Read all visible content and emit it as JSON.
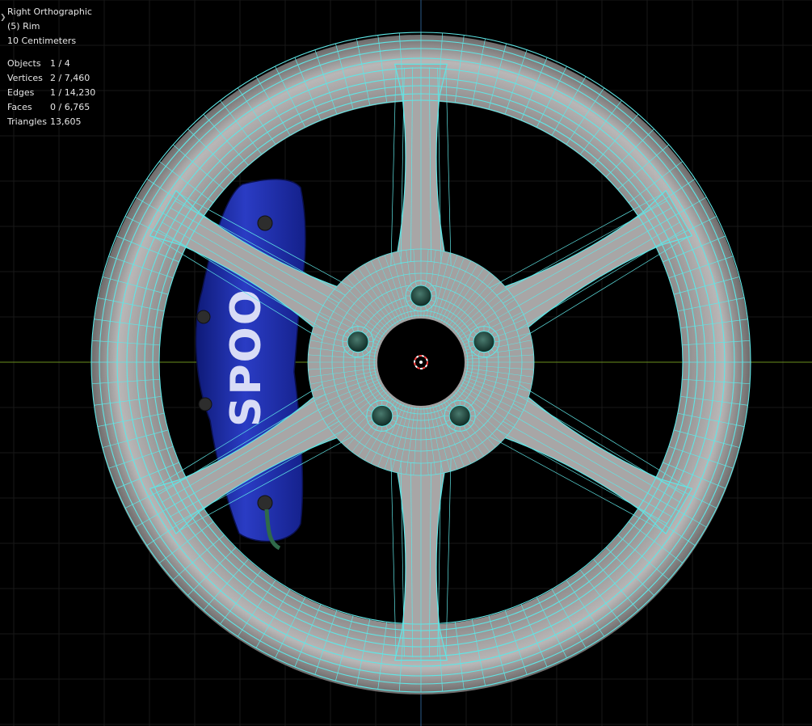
{
  "viewport": {
    "view_name": "Right Orthographic",
    "object_label": "(5) Rim",
    "scale_label": "10 Centimeters",
    "stats": [
      {
        "key": "Objects",
        "value": "1 / 4"
      },
      {
        "key": "Vertices",
        "value": "2 / 7,460"
      },
      {
        "key": "Edges",
        "value": "1 / 14,230"
      },
      {
        "key": "Faces",
        "value": "0 / 6,765"
      },
      {
        "key": "Triangles",
        "value": "13,605"
      }
    ],
    "caliper_logo_text": "SPOO",
    "colors": {
      "background": "#000000",
      "grid": "#1c1c1c",
      "axis_x": "#6a8f1e",
      "axis_y": "#2a5a8a",
      "wireframe": "#5fe6e6",
      "rim_fill": "#9a9898",
      "caliper": "#1f2fa8",
      "origin": "#ff4040"
    },
    "icons": {
      "cursor": "3d-cursor-icon",
      "expand": "chevron-right-icon"
    }
  }
}
